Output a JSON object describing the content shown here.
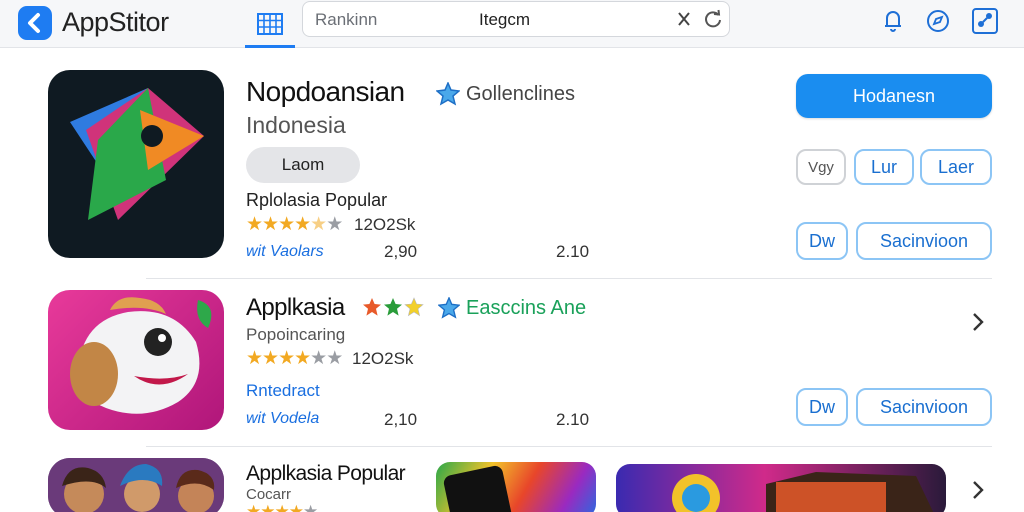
{
  "topbar": {
    "app_title": "AppStitor",
    "logo_icon": "appstore-logo-icon",
    "grid_icon": "grid-icon",
    "search": {
      "placeholder": "Rankinn",
      "value": "Itegcm"
    },
    "clear_icon": "close-icon",
    "reload_icon": "reload-icon",
    "right_icons": [
      "bell-icon",
      "compass-icon",
      "share-icon"
    ]
  },
  "colors": {
    "accent": "#1a8df0",
    "star": "#f2a922",
    "link": "#1a6fe0",
    "green": "#1aa15a"
  },
  "featured": {
    "title": "Nopdoansian",
    "developer": "Gollenclines",
    "subtitle": "Indonesia",
    "pill_label": "Laom",
    "category": "Rplolasia Popular",
    "rating": {
      "filled": 4.5,
      "max": 5,
      "count": "12O2Sk"
    },
    "link": "wit Vaolars",
    "num_a": "2,90",
    "num_b": "2.10",
    "primary_button": "Hodanesn",
    "button_small_1": "Vgy",
    "button_small_2": "Lur",
    "button_small_3": "Laer",
    "button_dw": "Dw",
    "button_wide": "Sacinvioon"
  },
  "second": {
    "title": "Applkasia",
    "developer": "Easccins Ane",
    "subtitle": "Popoincaring",
    "rating": {
      "filled": 4,
      "max": 5,
      "count": "12O2Sk"
    },
    "link_1": "Rntedract",
    "link_2": "wit Vodela",
    "num_a": "2,10",
    "num_b": "2.10",
    "button_dw": "Dw",
    "button_wide": "Sacinvioon"
  },
  "third": {
    "title": "Applkasia Popular",
    "subtitle": "Cocarr"
  }
}
